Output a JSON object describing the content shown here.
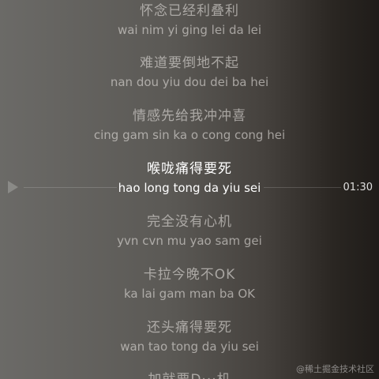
{
  "lyrics": [
    {
      "zh": "怀念已经利叠利",
      "py": "wai nim yi ging lei da lei"
    },
    {
      "zh": "难道要倒地不起",
      "py": "nan dou yiu dou dei ba hei"
    },
    {
      "zh": "情感先给我冲冲喜",
      "py": "cing gam sin ka o cong cong hei"
    },
    {
      "zh": "喉咙痛得要死",
      "py": "hao long tong da yiu sei"
    },
    {
      "zh": "完全没有心机",
      "py": "yvn cvn mu yao sam gei"
    },
    {
      "zh": "卡拉今晚不OK",
      "py": "ka lai gam man ba OK"
    },
    {
      "zh": "还头痛得要死",
      "py": "wan tao tong da yiu sei"
    },
    {
      "zh": "加就要D···机",
      "py": ""
    }
  ],
  "current_line_index": 3,
  "seek": {
    "time": "01:30",
    "play_icon": "play-triangle-icon"
  },
  "watermark": "@稀土掘金技术社区",
  "colors": {
    "active_text": "#ffffff",
    "inactive_text": "#e8e6e2"
  }
}
